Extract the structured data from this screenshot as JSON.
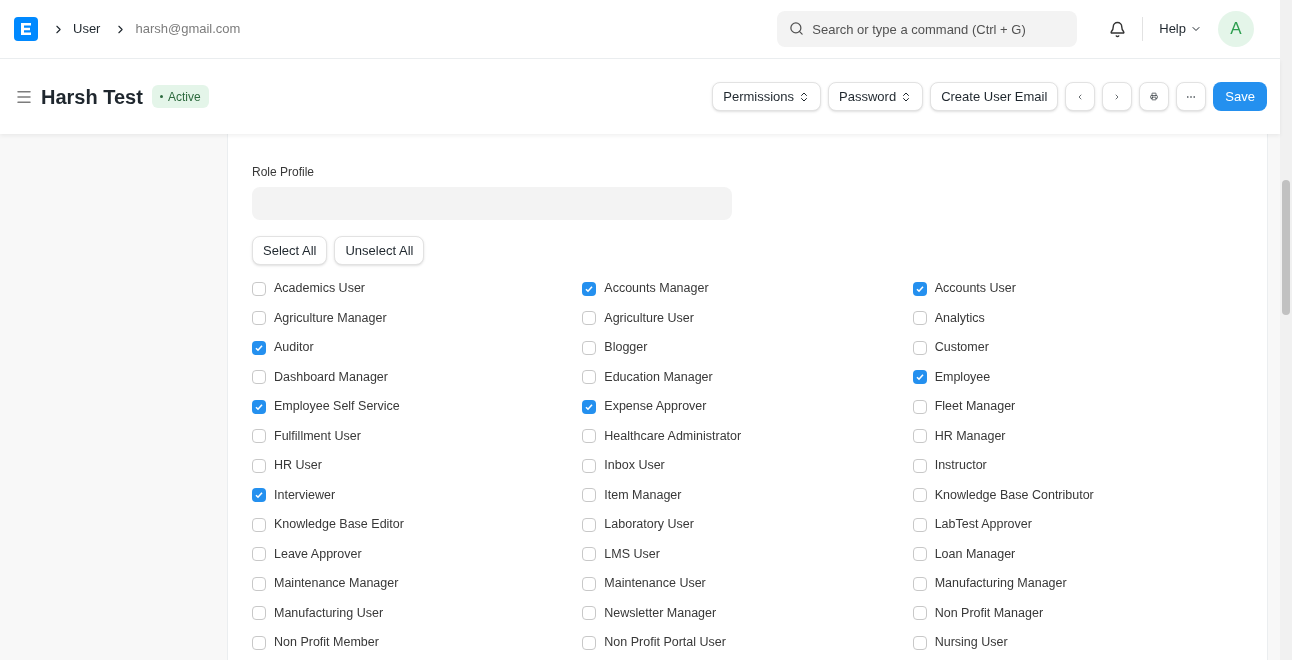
{
  "navbar": {
    "breadcrumbs": [
      "User",
      "harsh@gmail.com"
    ],
    "search": {
      "placeholder": "Search or type a command (Ctrl + G)"
    },
    "help": "Help",
    "avatar": "A"
  },
  "header": {
    "title": "Harsh Test",
    "status": "Active",
    "buttons": [
      {
        "kind": "dropdown",
        "label": "Permissions"
      },
      {
        "kind": "dropdown",
        "label": "Password"
      },
      {
        "kind": "plain",
        "label": "Create User Email"
      },
      {
        "kind": "prev"
      },
      {
        "kind": "next"
      },
      {
        "kind": "print"
      },
      {
        "kind": "more"
      },
      {
        "kind": "primary",
        "label": "Save"
      }
    ]
  },
  "roles": {
    "role_profile_label": "Role Profile",
    "select_all": "Select All",
    "unselect_all": "Unselect All",
    "items": [
      {
        "label": "Academics User",
        "checked": false
      },
      {
        "label": "Accounts Manager",
        "checked": true
      },
      {
        "label": "Accounts User",
        "checked": true
      },
      {
        "label": "Agriculture Manager",
        "checked": false
      },
      {
        "label": "Agriculture User",
        "checked": false
      },
      {
        "label": "Analytics",
        "checked": false
      },
      {
        "label": "Auditor",
        "checked": true
      },
      {
        "label": "Blogger",
        "checked": false
      },
      {
        "label": "Customer",
        "checked": false
      },
      {
        "label": "Dashboard Manager",
        "checked": false
      },
      {
        "label": "Education Manager",
        "checked": false
      },
      {
        "label": "Employee",
        "checked": true
      },
      {
        "label": "Employee Self Service",
        "checked": true
      },
      {
        "label": "Expense Approver",
        "checked": true
      },
      {
        "label": "Fleet Manager",
        "checked": false
      },
      {
        "label": "Fulfillment User",
        "checked": false
      },
      {
        "label": "Healthcare Administrator",
        "checked": false
      },
      {
        "label": "HR Manager",
        "checked": false
      },
      {
        "label": "HR User",
        "checked": false
      },
      {
        "label": "Inbox User",
        "checked": false
      },
      {
        "label": "Instructor",
        "checked": false
      },
      {
        "label": "Interviewer",
        "checked": true
      },
      {
        "label": "Item Manager",
        "checked": false
      },
      {
        "label": "Knowledge Base Contributor",
        "checked": false
      },
      {
        "label": "Knowledge Base Editor",
        "checked": false
      },
      {
        "label": "Laboratory User",
        "checked": false
      },
      {
        "label": "LabTest Approver",
        "checked": false
      },
      {
        "label": "Leave Approver",
        "checked": false
      },
      {
        "label": "LMS User",
        "checked": false
      },
      {
        "label": "Loan Manager",
        "checked": false
      },
      {
        "label": "Maintenance Manager",
        "checked": false
      },
      {
        "label": "Maintenance User",
        "checked": false
      },
      {
        "label": "Manufacturing Manager",
        "checked": false
      },
      {
        "label": "Manufacturing User",
        "checked": false
      },
      {
        "label": "Newsletter Manager",
        "checked": false
      },
      {
        "label": "Non Profit Manager",
        "checked": false
      },
      {
        "label": "Non Profit Member",
        "checked": false
      },
      {
        "label": "Non Profit Portal User",
        "checked": false
      },
      {
        "label": "Nursing User",
        "checked": false
      }
    ]
  }
}
